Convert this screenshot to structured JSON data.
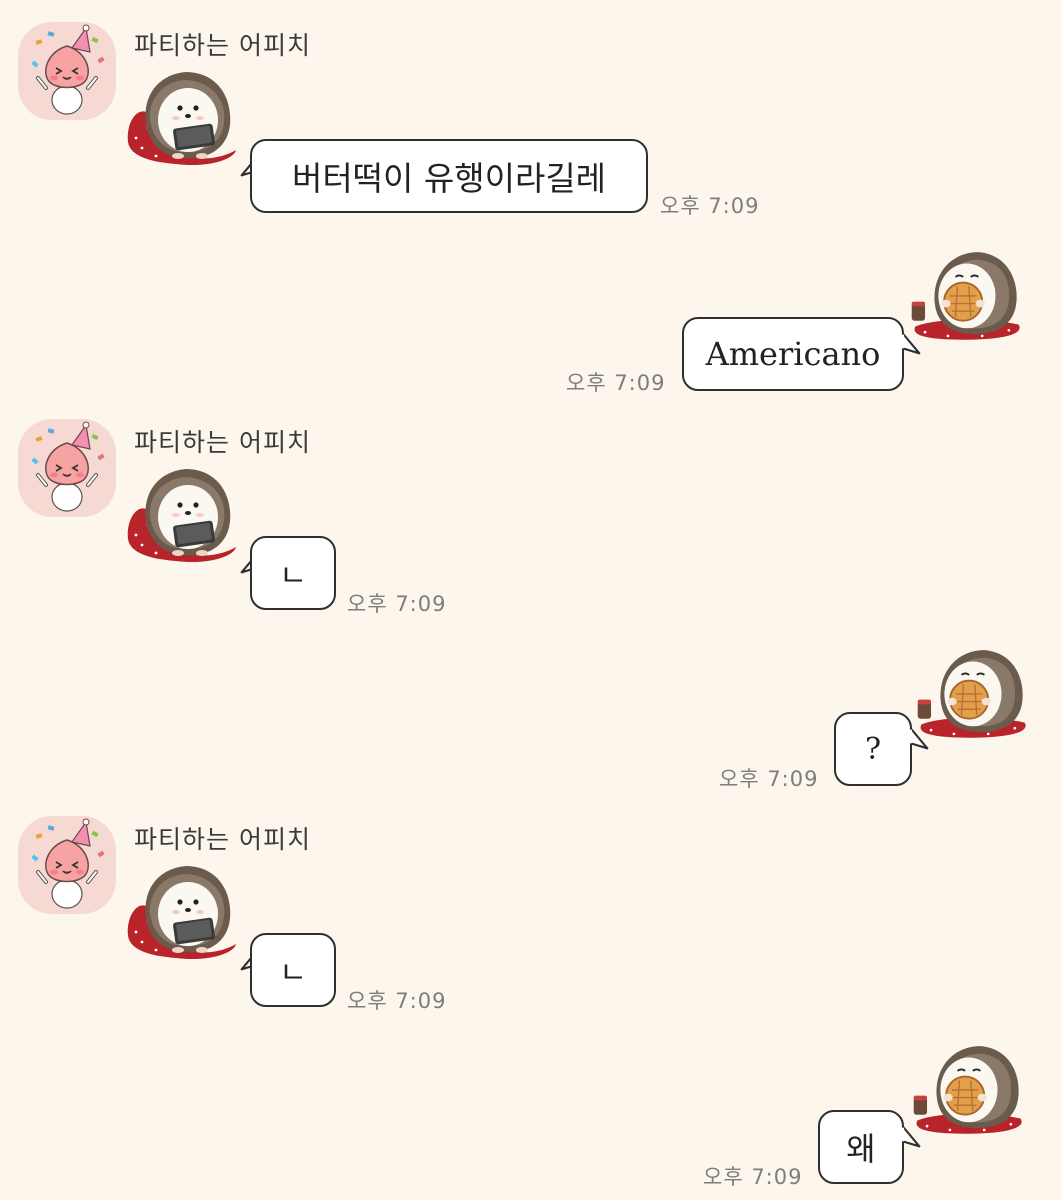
{
  "chat": {
    "sender_name": "파티하는 어피치",
    "messages": [
      {
        "side": "left",
        "text": "버터떡이 유행이라길레",
        "time": "오후 7:09"
      },
      {
        "side": "right",
        "text": "Americano",
        "time": "오후 7:09"
      },
      {
        "side": "left",
        "text": "ㄴ",
        "time": "오후 7:09"
      },
      {
        "side": "right",
        "text": "?",
        "time": "오후 7:09"
      },
      {
        "side": "left",
        "text": "ㄴ",
        "time": "오후 7:09"
      },
      {
        "side": "right",
        "text": "왜",
        "time": "오후 7:09"
      }
    ]
  },
  "icons": {
    "avatar": "apeach-party-avatar-icon",
    "left_sticker": "hedgehog-phone-sticker-icon",
    "right_sticker": "hedgehog-cookie-sticker-icon"
  },
  "colors": {
    "background": "#fdf6ec",
    "bubble": "#ffffff",
    "bubble_border": "#2f2f2f",
    "time_text": "#7d7d7d",
    "avatar_bg": "#f6d9d3"
  }
}
